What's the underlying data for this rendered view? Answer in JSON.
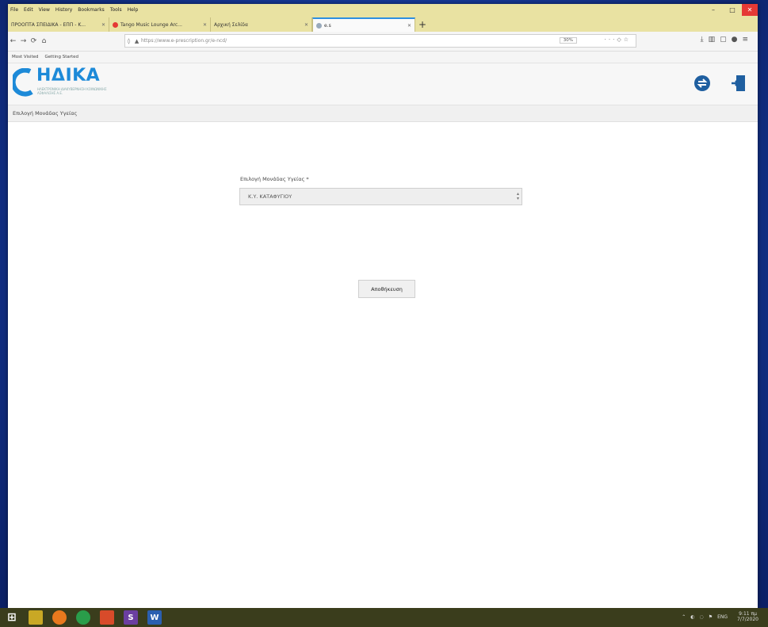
{
  "browser": {
    "menu": [
      "File",
      "Edit",
      "View",
      "History",
      "Bookmarks",
      "Tools",
      "Help"
    ],
    "tabs": [
      {
        "title": "ΠΡΟΟΠΤΑ ΣΠΕΙΔΙΚΑ - ΕΠΠ - Κ...",
        "active": false
      },
      {
        "title": "Tango Music Lounge Arc...",
        "active": false
      },
      {
        "title": "Αρχική Σελίδα",
        "active": false
      },
      {
        "title": "e.s",
        "active": true
      }
    ],
    "url": "https://www.e-prescription.gr/e-ncd/",
    "zoom": "30%",
    "bookmarks": [
      "Most Visited",
      "Getting Started"
    ]
  },
  "site": {
    "logo_word": "ΗΔΙΚΑ",
    "logo_sub": "ΗΛΕΚΤΡΟΝΙΚΗ ΔΙΑΚΥΒΕΡΝΗΣΗ ΚΟΙΝΩΝΙΚΗΣ ΑΣΦΑΛΙΣΗΣ Α.Ε.",
    "subnav": "Επιλογή Μονάδας Υγείας",
    "field_label": "Επιλογή Μονάδας Υγείας *",
    "field_value": "Κ.Υ. ΚΑΤΑΦΥΓΙΟΥ",
    "save_button": "Αποθήκευση"
  },
  "taskbar": {
    "time": "9:11 πμ",
    "date": "7/7/2020",
    "lang": "ENG"
  },
  "colors": {
    "accent": "#1d8ad8",
    "chrome_bar": "#e9e2a2",
    "taskbar": "#3a3d1c"
  }
}
